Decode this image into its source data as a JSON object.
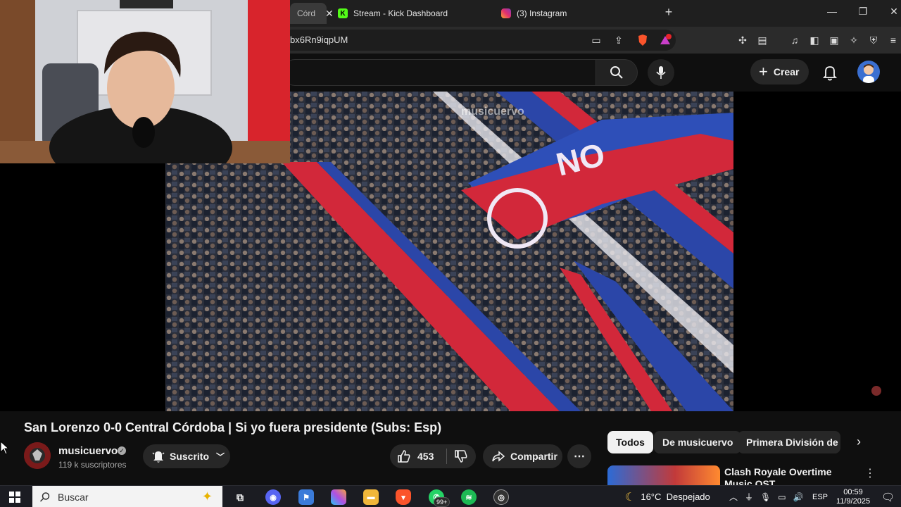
{
  "browser": {
    "tabs": [
      {
        "label": "Córd",
        "active": true
      },
      {
        "label": "Stream - Kick Dashboard",
        "active": false
      },
      {
        "label": "(3) Instagram",
        "active": false
      }
    ],
    "new_tab": "+",
    "url": "bx6Rn9iqpUM",
    "shield_badge": "1"
  },
  "youtube": {
    "create_label": "Crear",
    "watermark": "musicuervo",
    "video": {
      "title": "San Lorenzo 0-0 Central Córdoba | Si yo fuera presidente (Subs: Esp)",
      "channel": "musicuervo",
      "subscribers": "119 k suscriptores",
      "subscribed_label": "Suscrito",
      "likes": "453",
      "share_label": "Compartir"
    },
    "chips": [
      {
        "label": "Todos",
        "active": true
      },
      {
        "label": "De musicuervo",
        "active": false
      },
      {
        "label": "Primera División de Ar",
        "active": false
      }
    ],
    "recommendation": {
      "title": "Clash Royale Overtime Music OST"
    }
  },
  "taskbar": {
    "search_placeholder": "Buscar",
    "badge": "99+",
    "weather": "16°C  Despejado",
    "lang": "ESP",
    "time": "00:59",
    "date": "11/9/2025"
  },
  "colors": {
    "accent_red": "#e8242a",
    "stripe_blue": "#2e4fb8",
    "kick_green": "#53fc18",
    "spotify_green": "#1db954"
  }
}
